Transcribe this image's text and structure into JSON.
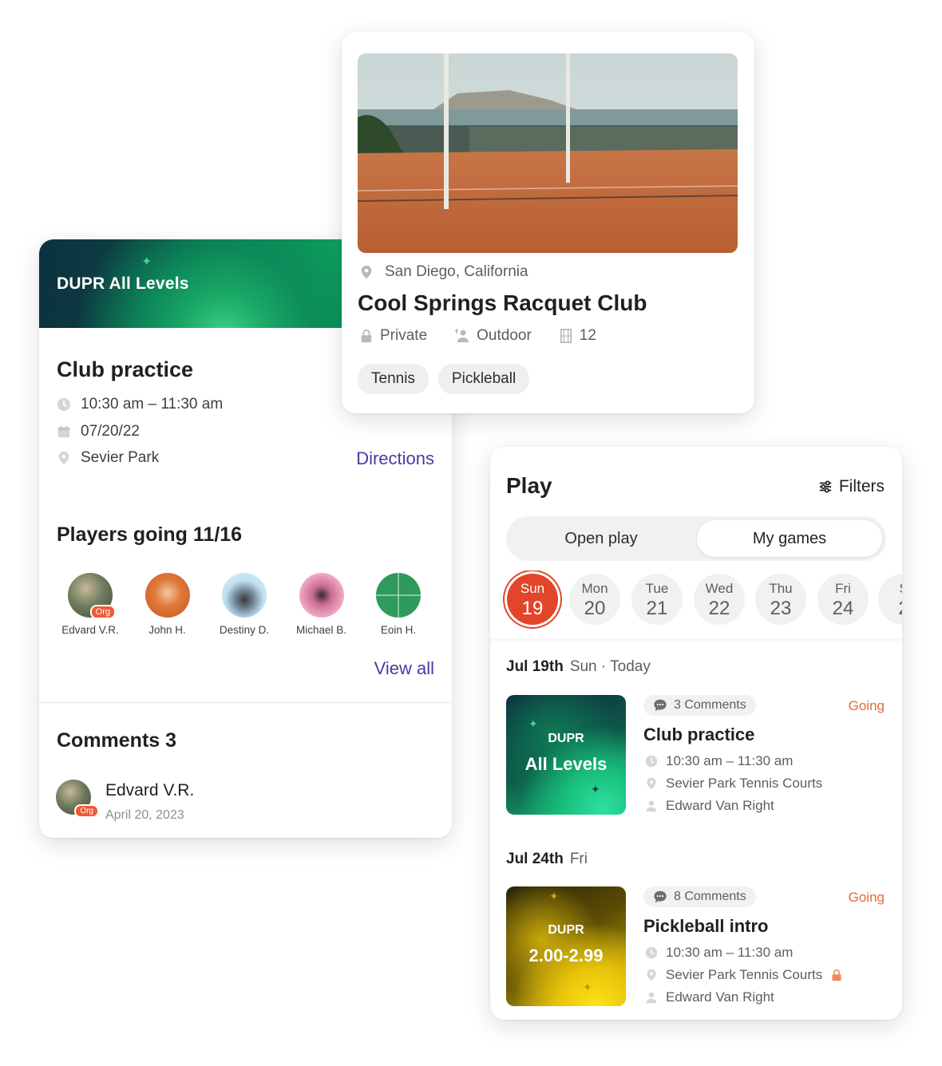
{
  "event": {
    "banner_title": "DUPR All Levels",
    "title": "Club practice",
    "time": "10:30 am – 11:30 am",
    "date": "07/20/22",
    "location": "Sevier Park",
    "directions_label": "Directions",
    "players_title": "Players going  11/16",
    "players": [
      {
        "name": "Edvard V.R.",
        "badge": "Org",
        "color": "#5c6a50"
      },
      {
        "name": "John H.",
        "badge": "",
        "color": "#d9682f"
      },
      {
        "name": "Destiny D.",
        "badge": "",
        "color": "#a9cfe6"
      },
      {
        "name": "Michael B.",
        "badge": "",
        "color": "#e98fb5"
      },
      {
        "name": "Eoin H.",
        "badge": "",
        "color": "#2f9a5c"
      }
    ],
    "view_all_label": "View all",
    "comments_title": "Comments  3",
    "comment": {
      "author": "Edvard V.R.",
      "badge": "Org",
      "date": "April 20, 2023"
    }
  },
  "club": {
    "location": "San Diego, California",
    "name": "Cool Springs Racquet Club",
    "access": "Private",
    "setting": "Outdoor",
    "courts": "12",
    "sports": [
      "Tennis",
      "Pickleball"
    ]
  },
  "play": {
    "title": "Play",
    "filters_label": "Filters",
    "tabs": {
      "left": "Open play",
      "right": "My games"
    },
    "days": [
      {
        "name": "Sun",
        "num": "19",
        "selected": true
      },
      {
        "name": "Mon",
        "num": "20"
      },
      {
        "name": "Tue",
        "num": "21"
      },
      {
        "name": "Wed",
        "num": "22"
      },
      {
        "name": "Thu",
        "num": "23"
      },
      {
        "name": "Fri",
        "num": "24"
      },
      {
        "name": "S",
        "num": "2"
      }
    ],
    "sections": [
      {
        "date": "Jul 19th",
        "sub": "Sun · Today",
        "game": {
          "thumb_line1": "DUPR",
          "thumb_line2": "All Levels",
          "comments": "3 Comments",
          "status": "Going",
          "title": "Club practice",
          "time": "10:30 am – 11:30 am",
          "location": "Sevier Park Tennis Courts",
          "organizer": "Edward Van Right"
        }
      },
      {
        "date": "Jul 24th",
        "sub": "Fri",
        "game": {
          "thumb_line1": "DUPR",
          "thumb_line2": "2.00-2.99",
          "comments": "8 Comments",
          "status": "Going",
          "title": "Pickleball intro",
          "time": "10:30 am – 11:30 am",
          "location": "Sevier Park Tennis Courts",
          "organizer": "Edward Van Right"
        }
      }
    ]
  },
  "colors": {
    "accent_purple": "#4a3aa6",
    "selected_day": "#e2452a",
    "going": "#e8663e",
    "org_badge": "#ef5a37"
  }
}
